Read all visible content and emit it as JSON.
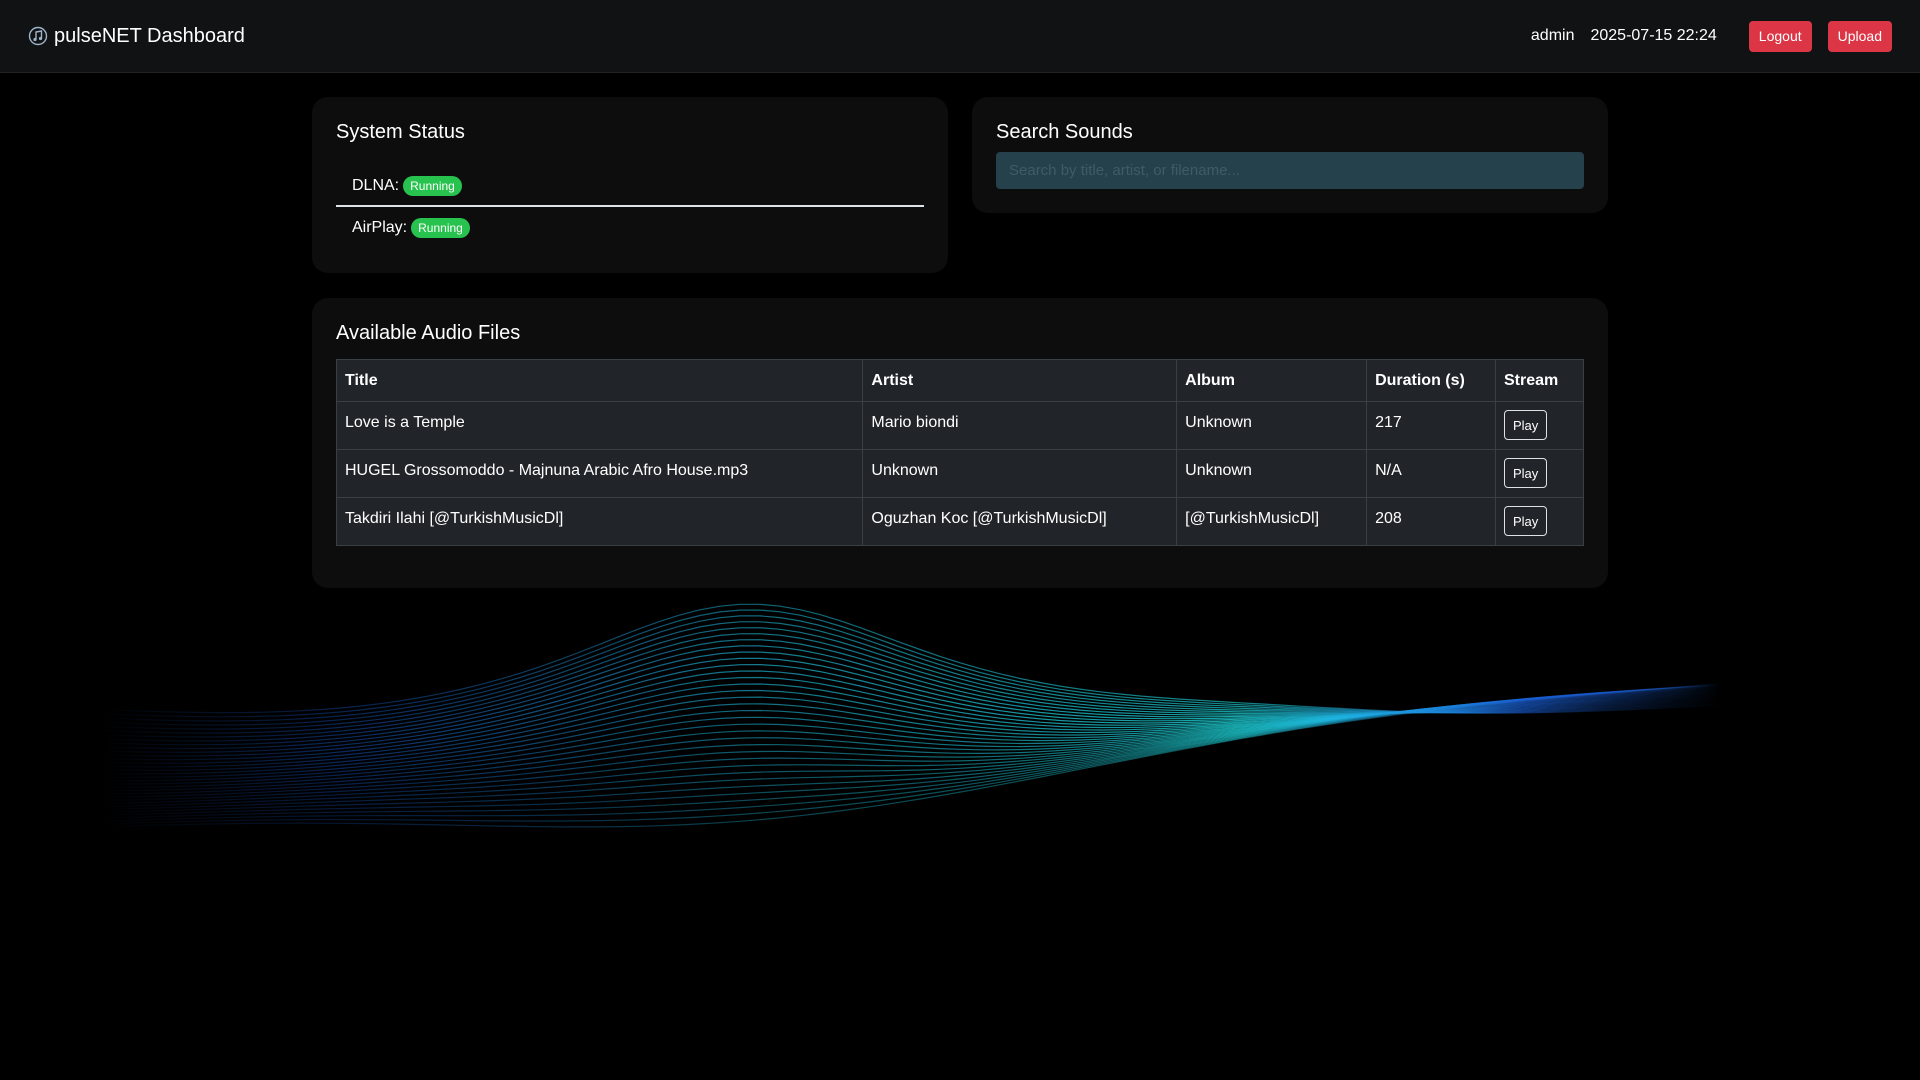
{
  "navbar": {
    "brand_title": "pulseNET Dashboard",
    "brand_icon": "music-note-icon",
    "user": "admin",
    "datetime": "2025-07-15 22:24",
    "logout_label": "Logout",
    "upload_label": "Upload"
  },
  "system_status": {
    "title": "System Status",
    "services": [
      {
        "label": "DLNA:",
        "status": "Running"
      },
      {
        "label": "AirPlay:",
        "status": "Running"
      }
    ]
  },
  "search": {
    "title": "Search Sounds",
    "placeholder": "Search by title, artist, or filename...",
    "value": ""
  },
  "audio_files": {
    "title": "Available Audio Files",
    "columns": [
      "Title",
      "Artist",
      "Album",
      "Duration (s)",
      "Stream"
    ],
    "rows": [
      {
        "title": "Love is a Temple",
        "artist": "Mario biondi",
        "album": "Unknown",
        "duration": "217",
        "stream_label": "Play"
      },
      {
        "title": "HUGEL Grossomoddo - Majnuna Arabic Afro House.mp3",
        "artist": "Unknown",
        "album": "Unknown",
        "duration": "N/A",
        "stream_label": "Play"
      },
      {
        "title": "Takdiri Ilahi [@TurkishMusicDl]",
        "artist": "Oguzhan Koc [@TurkishMusicDl]",
        "album": "[@TurkishMusicDl]",
        "duration": "208",
        "stream_label": "Play"
      }
    ]
  },
  "colors": {
    "accent_red": "#dc3545",
    "badge_green": "#28c34f",
    "wave_cyan": "#1fe3e8",
    "wave_blue": "#1a5fd6"
  }
}
